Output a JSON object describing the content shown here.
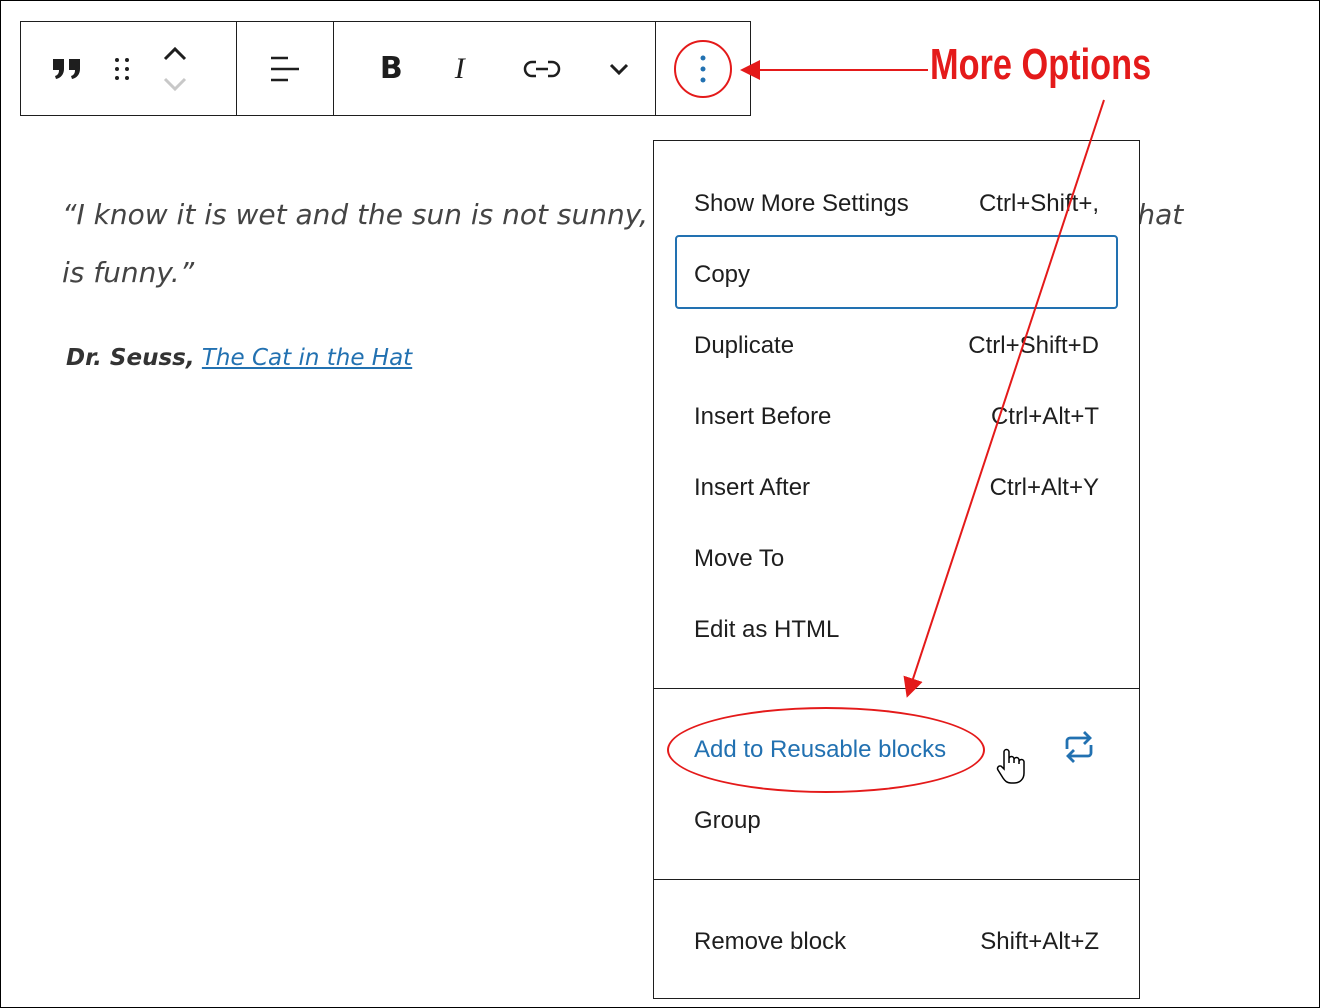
{
  "toolbar": {
    "quote_icon": "quote-icon",
    "drag_icon": "drag-handle-icon",
    "move_icon": "move-up-down-icon",
    "align_icon": "align-text-icon",
    "bold_label": "B",
    "italic_label": "I",
    "link_icon": "link-icon",
    "more_rich_icon": "chevron-down-icon",
    "options_icon": "vertical-ellipsis-icon"
  },
  "content": {
    "quote_text": "“I know it is wet and the sun is not sunny, but we can have lots of good fun that is funny.”",
    "cite_author": "Dr. Seuss,",
    "cite_title": "The Cat in the Hat"
  },
  "annotation": {
    "label": "More Options",
    "color": "#e41a1a"
  },
  "menu": {
    "items": [
      {
        "label": "Show More Settings",
        "shortcut": "Ctrl+Shift+,"
      },
      {
        "label": "Copy",
        "shortcut": ""
      },
      {
        "label": "Duplicate",
        "shortcut": "Ctrl+Shift+D"
      },
      {
        "label": "Insert Before",
        "shortcut": "Ctrl+Alt+T"
      },
      {
        "label": "Insert After",
        "shortcut": "Ctrl+Alt+Y"
      },
      {
        "label": "Move To",
        "shortcut": ""
      },
      {
        "label": "Edit as HTML",
        "shortcut": ""
      }
    ],
    "reusable_label": "Add to Reusable blocks",
    "group_label": "Group",
    "remove_label": "Remove block",
    "remove_shortcut": "Shift+Alt+Z"
  },
  "colors": {
    "accent": "#2271b1",
    "annotation": "#e41a1a"
  }
}
